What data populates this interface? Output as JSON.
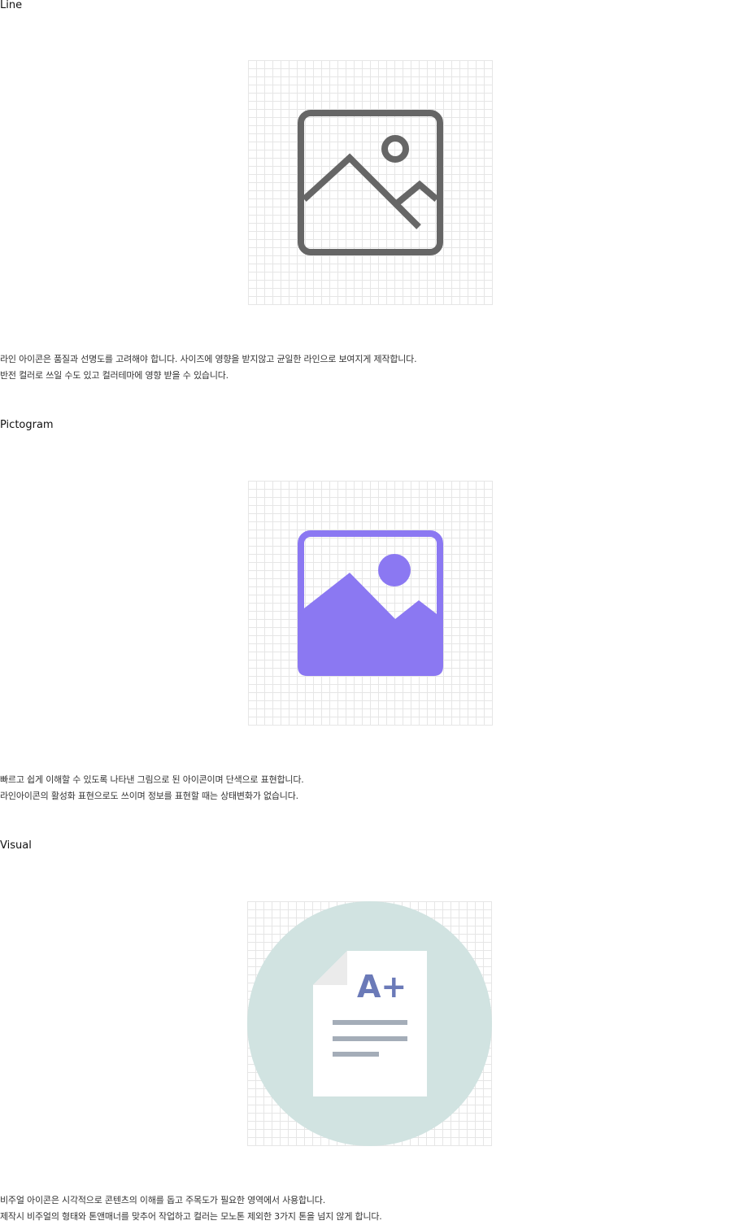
{
  "sections": [
    {
      "title": "Line",
      "icon": "image-line-icon",
      "color": "#666666",
      "lines": [
        "라인 아이콘은 품질과 선명도를 고려해야 합니다. 사이즈에 영향을 받지않고 균일한  라인으로 보여지게 제작합니다.",
        "반전 컬러로 쓰일 수도 있고 컬러테마에 영향 받을 수 있습니다."
      ]
    },
    {
      "title": "Pictogram",
      "icon": "image-pictogram-icon",
      "color": "#8b78f2",
      "lines": [
        "빠르고 쉽게 이해할 수 있도록 나타낸 그림으로 된 아이콘이며  단색으로 표현합니다.",
        "라인아이콘의 활성화 표현으로도 쓰이며 정보를 표현할 때는 상태변화가 없습니다."
      ]
    },
    {
      "title": "Visual",
      "icon": "document-grade-icon",
      "color": "#d1e3e1",
      "badge": "A+",
      "lines": [
        "비주얼 아이콘은 시각적으로 콘텐츠의 이해를 돕고 주목도가 필요한 영역에서 사용합니다.",
        "제작시 비주얼의 형태와 톤앤매너를 맞추어 작업하고 컬러는 모노톤 제외한 3가지 톤을 넘지 않게 합니다."
      ]
    }
  ]
}
